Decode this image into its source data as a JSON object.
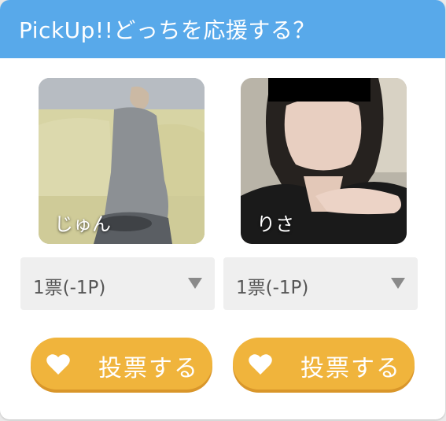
{
  "header": {
    "title": "PickUp!!どっちを応援する？"
  },
  "candidates": [
    {
      "name": "じゅん",
      "vote_select": {
        "value": "1票(-1P)"
      },
      "vote_button": {
        "label": "投票する",
        "icon": "heart-icon"
      }
    },
    {
      "name": "りさ",
      "vote_select": {
        "value": "1票(-1P)"
      },
      "vote_button": {
        "label": "投票する",
        "icon": "heart-icon"
      }
    }
  ],
  "colors": {
    "header": "#58a9ea",
    "button": "#f0b43c",
    "select_bg": "#efefef"
  }
}
